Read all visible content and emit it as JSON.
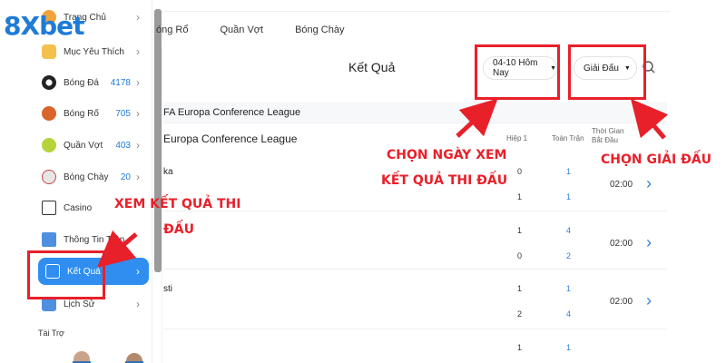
{
  "logo": {
    "text": "8Xbet"
  },
  "sidebar": {
    "items": [
      {
        "label": "Trang Chủ",
        "count": "",
        "icon": "home-icon",
        "color": "#f2a33a"
      },
      {
        "label": "Mục Yêu Thích",
        "count": "",
        "icon": "favorite-icon",
        "color": "#f2c14e"
      },
      {
        "label": "Bóng Đá",
        "count": "4178",
        "icon": "football-icon",
        "color": "#222222"
      },
      {
        "label": "Bóng Rổ",
        "count": "705",
        "icon": "basketball-icon",
        "color": "#d9652b"
      },
      {
        "label": "Quần Vợt",
        "count": "403",
        "icon": "tennis-icon",
        "color": "#b5d43a"
      },
      {
        "label": "Bóng Chày",
        "count": "20",
        "icon": "baseball-icon",
        "color": "#d8d8d8"
      },
      {
        "label": "Casino",
        "count": "",
        "icon": "cards-icon",
        "color": "#333333"
      },
      {
        "label": "Thông Tin Trận",
        "count": "",
        "icon": "stats-icon",
        "color": "#4f8fe0"
      },
      {
        "label": "Kết Quả",
        "count": "",
        "icon": "results-icon",
        "color": "#ffffff"
      },
      {
        "label": "Lịch Sử",
        "count": "",
        "icon": "history-icon",
        "color": "#4f8fe0"
      }
    ],
    "sponsor_label": "Tài Trợ"
  },
  "tabs": [
    "óng Rổ",
    "Quần Vợt",
    "Bóng Chày"
  ],
  "main": {
    "title": "Kết Quả",
    "date_filter": "04-10 Hôm Nay",
    "league_filter": "Giải Đấu",
    "league_header": "FA Europa Conference League",
    "league_sub": "Europa Conference League",
    "columns": {
      "half": "Hiệp 1",
      "full": "Toàn Trận",
      "time": "Thời Gian Bắt Đầu"
    },
    "matches": [
      {
        "team_a": "ka",
        "team_b": "",
        "half": [
          "0",
          "1"
        ],
        "full": [
          "1",
          "1"
        ],
        "time": "02:00"
      },
      {
        "team_a": "",
        "team_b": "",
        "half": [
          "1",
          "0"
        ],
        "full": [
          "4",
          "2"
        ],
        "time": "02:00"
      },
      {
        "team_a": "sti",
        "team_b": "",
        "half": [
          "1",
          "2"
        ],
        "full": [
          "1",
          "4"
        ],
        "time": "02:00"
      },
      {
        "team_a": "",
        "team_b": "",
        "half": [
          "1",
          ""
        ],
        "full": [
          "1",
          ""
        ],
        "time": ""
      }
    ]
  },
  "annotations": {
    "date_callout": [
      "CHỌN NGÀY XEM",
      "KẾT QUẢ THI ĐẤU"
    ],
    "league_callout": "CHỌN GIẢI ĐẤU",
    "results_callout": [
      "XEM KẾT QUẢ THI",
      "ĐẤU"
    ],
    "color": "#e8202a"
  }
}
